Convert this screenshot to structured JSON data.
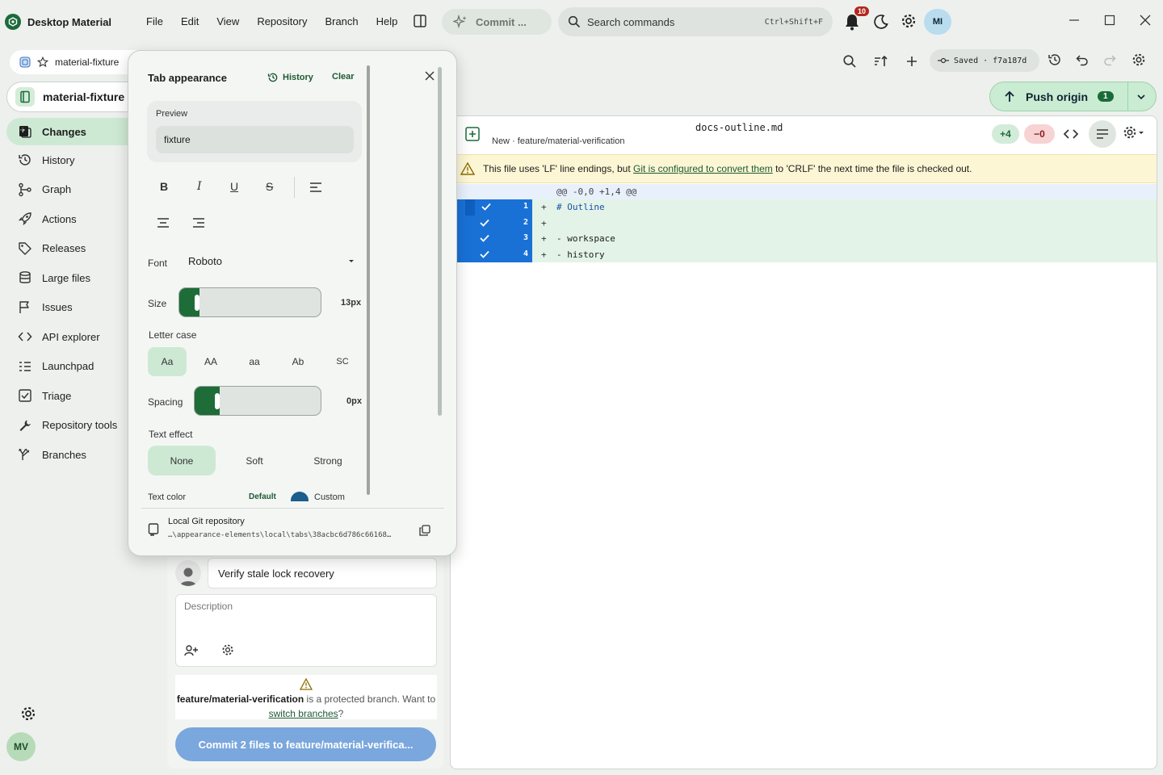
{
  "app": {
    "name": "Desktop Material"
  },
  "menu": [
    "File",
    "Edit",
    "View",
    "Repository",
    "Branch",
    "Help"
  ],
  "commit_pill": "Commit ...",
  "search": {
    "placeholder": "Search commands",
    "shortcut": "Ctrl+Shift+F"
  },
  "notifications": {
    "count": "10"
  },
  "user": {
    "initials": "MI",
    "side_initials": "MV"
  },
  "tab": {
    "label": "material-fixture"
  },
  "repo": {
    "name": "material-fixture"
  },
  "nav": [
    {
      "label": "Changes",
      "icon": "changes-icon"
    },
    {
      "label": "History",
      "icon": "history-icon"
    },
    {
      "label": "Graph",
      "icon": "graph-icon"
    },
    {
      "label": "Actions",
      "icon": "rocket-icon"
    },
    {
      "label": "Releases",
      "icon": "tag-icon"
    },
    {
      "label": "Large files",
      "icon": "database-icon"
    },
    {
      "label": "Issues",
      "icon": "flag-icon"
    },
    {
      "label": "API explorer",
      "icon": "code-icon"
    },
    {
      "label": "Launchpad",
      "icon": "list-icon"
    },
    {
      "label": "Triage",
      "icon": "checklist-icon"
    },
    {
      "label": "Repository tools",
      "icon": "wrench-icon"
    },
    {
      "label": "Branches",
      "icon": "branch-icon"
    }
  ],
  "toolbar": {
    "saved": "Saved · f7a187d"
  },
  "push": {
    "label": "Push origin",
    "count": "1"
  },
  "diff": {
    "file": "docs-outline.md",
    "subtitle": "New · feature/material-verification",
    "added": "+4",
    "removed": "−0",
    "warning_pre": "This file uses 'LF' line endings, but ",
    "warning_link": "Git is configured to convert them",
    "warning_post": " to 'CRLF' the next time the file is checked out.",
    "hunk": "@@ -0,0 +1,4 @@",
    "lines": [
      {
        "num": "1",
        "sign": "+",
        "code": "# Outline"
      },
      {
        "num": "2",
        "sign": "+",
        "code": ""
      },
      {
        "num": "3",
        "sign": "+",
        "code": "- workspace"
      },
      {
        "num": "4",
        "sign": "+",
        "code": "- history"
      }
    ]
  },
  "commit": {
    "summary": "Verify stale lock recovery",
    "description_placeholder": "Description",
    "protected_branch": "feature/material-verification",
    "protected_mid": " is a protected branch. Want to ",
    "protected_link": "switch branches",
    "protected_end": "?",
    "button": "Commit 2 files to feature/material-verifica..."
  },
  "popover": {
    "title": "Tab appearance",
    "history": "History",
    "clear": "Clear",
    "preview_label": "Preview",
    "preview_value": "fixture",
    "format_buttons": [
      "B",
      "I",
      "U",
      "S"
    ],
    "font_label": "Font",
    "font_value": "Roboto",
    "size_label": "Size",
    "size_value": "13px",
    "size_level": 0.14,
    "letter_case_label": "Letter case",
    "letter_case": [
      "Aa",
      "AA",
      "aa",
      "Ab",
      "SC"
    ],
    "spacing_label": "Spacing",
    "spacing_value": "0px",
    "spacing_level": 0.2,
    "text_effect_label": "Text effect",
    "text_effect": [
      "None",
      "Soft",
      "Strong"
    ],
    "text_color_label": "Text color",
    "text_color_default": "Default",
    "text_color_custom": "Custom",
    "footer_title": "Local Git repository",
    "footer_path": "…\\appearance-elements\\local\\tabs\\38acbc6d786c66168…"
  },
  "colors": {
    "accent": "#1e6c37",
    "selection": "#1971d6",
    "commit_button": "#7aa7dd"
  }
}
